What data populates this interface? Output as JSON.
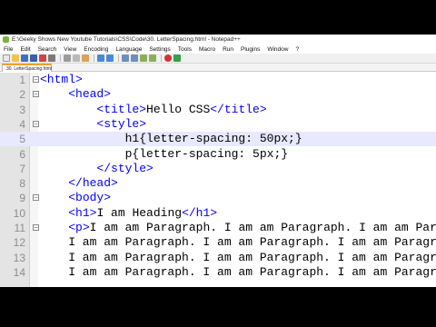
{
  "window": {
    "title": "E:\\Geeky Shows New Youtube Tutorials\\CSS\\Code\\30. LetterSpacing.html - Notepad++"
  },
  "menu": [
    "File",
    "Edit",
    "Search",
    "View",
    "Encoding",
    "Language",
    "Settings",
    "Tools",
    "Macro",
    "Run",
    "Plugins",
    "Window",
    "?"
  ],
  "tab": {
    "label": "30. LetterSpacing.html"
  },
  "editor": {
    "current_line": 5,
    "lines": [
      {
        "num": "1",
        "text": "<html>"
      },
      {
        "num": "2",
        "text": "    <head>"
      },
      {
        "num": "3",
        "text": "        <title>Hello CSS</title>"
      },
      {
        "num": "4",
        "text": "        <style>"
      },
      {
        "num": "5",
        "text": "            h1{letter-spacing: 50px;}"
      },
      {
        "num": "6",
        "text": "            p{letter-spacing: 5px;}"
      },
      {
        "num": "7",
        "text": "        </style>"
      },
      {
        "num": "8",
        "text": "    </head>"
      },
      {
        "num": "9",
        "text": "    <body>"
      },
      {
        "num": "10",
        "text": "    <h1>I am Heading</h1>"
      },
      {
        "num": "11",
        "text": "    <p>I am am Paragraph. I am am Paragraph. I am am Paragraph."
      },
      {
        "num": "12",
        "text": "    I am am Paragraph. I am am Paragraph. I am am Paragraph."
      },
      {
        "num": "13",
        "text": "    I am am Paragraph. I am am Paragraph. I am am Paragraph."
      },
      {
        "num": "14",
        "text": "    I am am Paragraph. I am am Paragraph. I am am Paragraph."
      }
    ]
  },
  "colors": {
    "tag": "#0000ff",
    "current_line_bg": "#e8e8ff",
    "gutter_bg": "#e4e4e4"
  },
  "icons": [
    "new-file-icon",
    "open-file-icon",
    "save-icon",
    "save-all-icon",
    "close-icon",
    "print-icon",
    "cut-icon",
    "copy-icon",
    "paste-icon",
    "undo-icon",
    "redo-icon",
    "find-icon",
    "replace-icon",
    "zoom-in-icon",
    "zoom-out-icon",
    "record-macro-icon",
    "play-macro-icon"
  ]
}
